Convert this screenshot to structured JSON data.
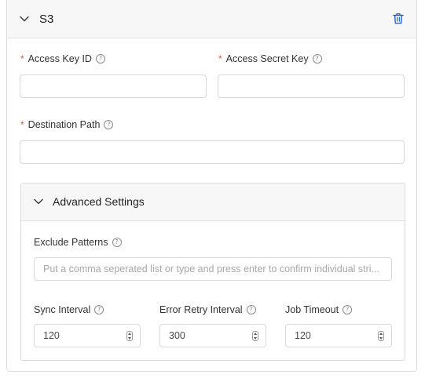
{
  "header": {
    "title": "S3"
  },
  "fields": {
    "access_key_id": {
      "label": "Access Key ID",
      "required_mark": "*",
      "value": "",
      "placeholder": ""
    },
    "access_secret_key": {
      "label": "Access Secret Key",
      "required_mark": "*",
      "value": "",
      "placeholder": ""
    },
    "destination_path": {
      "label": "Destination Path",
      "required_mark": "*",
      "value": "",
      "placeholder": ""
    }
  },
  "advanced": {
    "title": "Advanced Settings",
    "exclude_patterns": {
      "label": "Exclude Patterns",
      "placeholder": "Put a comma seperated list or type and press enter to confirm individual stri..."
    },
    "sync_interval": {
      "label": "Sync Interval",
      "value": "120"
    },
    "error_retry_interval": {
      "label": "Error Retry Interval",
      "value": "300"
    },
    "job_timeout": {
      "label": "Job Timeout",
      "value": "120"
    }
  },
  "icons": {
    "collapse": "chevron-down-icon",
    "delete": "trash-icon",
    "help": "help-circle-icon",
    "spinner": "number-stepper-icon"
  },
  "colors": {
    "accent": "#1a66d6",
    "required": "#e5484d",
    "header_bg": "#f7f7f7",
    "border": "#d9d9d9"
  },
  "help_glyph": "?"
}
